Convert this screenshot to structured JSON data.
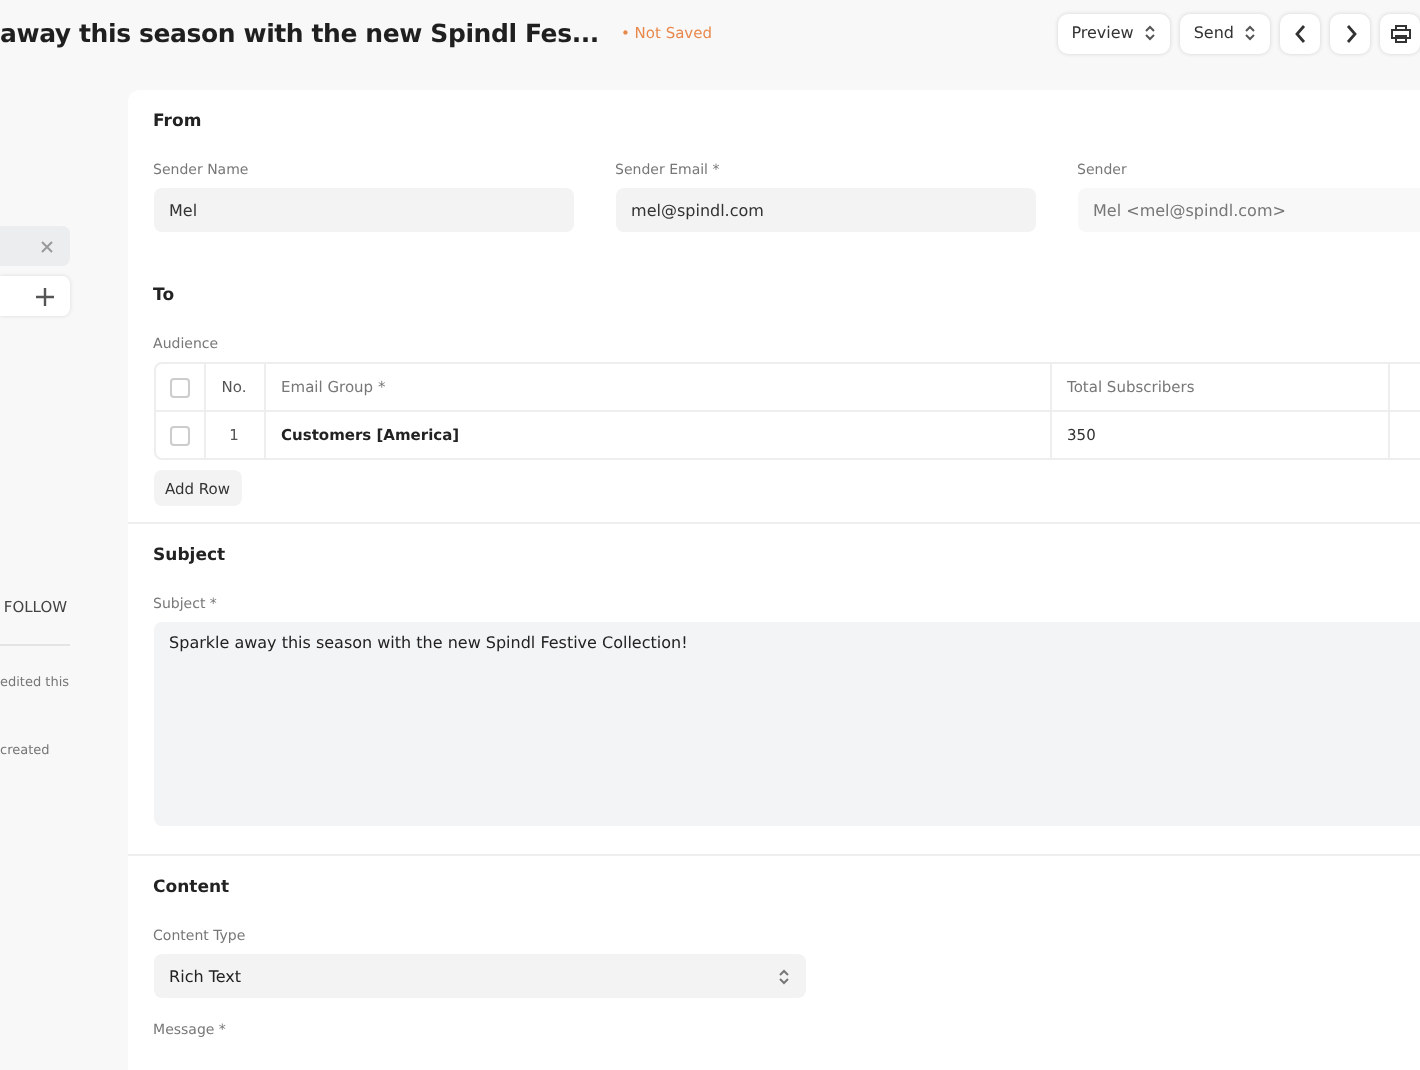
{
  "header": {
    "title": "away this season with the new Spindl Fes...",
    "status": "• Not Saved",
    "buttons": [
      {
        "kind": "select",
        "label": "Preview"
      },
      {
        "kind": "select",
        "label": "Send"
      },
      {
        "kind": "prev"
      },
      {
        "kind": "next"
      },
      {
        "kind": "print"
      }
    ]
  },
  "sidebar": {
    "follow": "FOLLOW",
    "activity": [
      "edited this",
      "created"
    ]
  },
  "from": {
    "title": "From",
    "fields": [
      {
        "label": "Sender Name",
        "value": "Mel",
        "readonly": false
      },
      {
        "label": "Sender Email *",
        "value": "mel@spindl.com",
        "readonly": false
      },
      {
        "label": "Sender",
        "value": "Mel <mel@spindl.com>",
        "readonly": true
      }
    ]
  },
  "to": {
    "title": "To",
    "audience_label": "Audience",
    "table": {
      "select_all": false,
      "columns": [
        "No.",
        "Email Group *",
        "Total Subscribers"
      ],
      "rows": [
        {
          "checked": false,
          "no": "1",
          "email_group": "Customers [America]",
          "total_subscribers": "350"
        }
      ]
    },
    "add_row": "Add Row"
  },
  "subject": {
    "title": "Subject",
    "label": "Subject *",
    "value": "Sparkle away this season with the new Spindl Festive Collection!"
  },
  "content": {
    "title": "Content",
    "type_label": "Content Type",
    "type_value": "Rich Text",
    "message_label": "Message *"
  }
}
